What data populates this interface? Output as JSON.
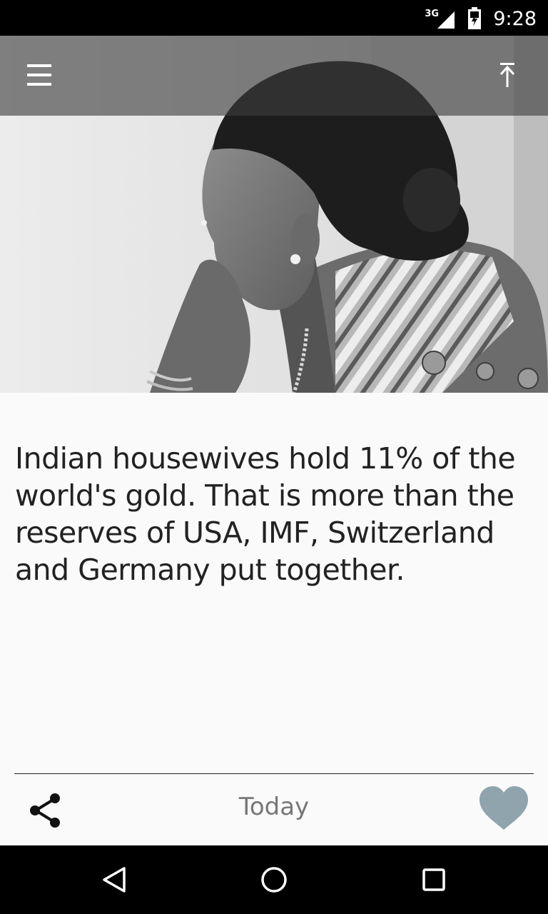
{
  "status_bar": {
    "network": "3G",
    "time": "9:28"
  },
  "toolbar": {
    "menu_icon": "hamburger-menu-icon",
    "scroll_top_icon": "arrow-to-top-icon"
  },
  "card": {
    "fact_text": "Indian housewives hold 11% of the world's gold. That is more than the reserves of USA, IMF, Switzerland and Germany put together.",
    "date_label": "Today",
    "share_icon": "share-icon",
    "favorite_icon": "heart-icon",
    "favorite_color": "#90a4ae"
  },
  "nav_bar": {
    "back_icon": "back-triangle-icon",
    "home_icon": "home-circle-icon",
    "recents_icon": "recents-square-icon"
  }
}
